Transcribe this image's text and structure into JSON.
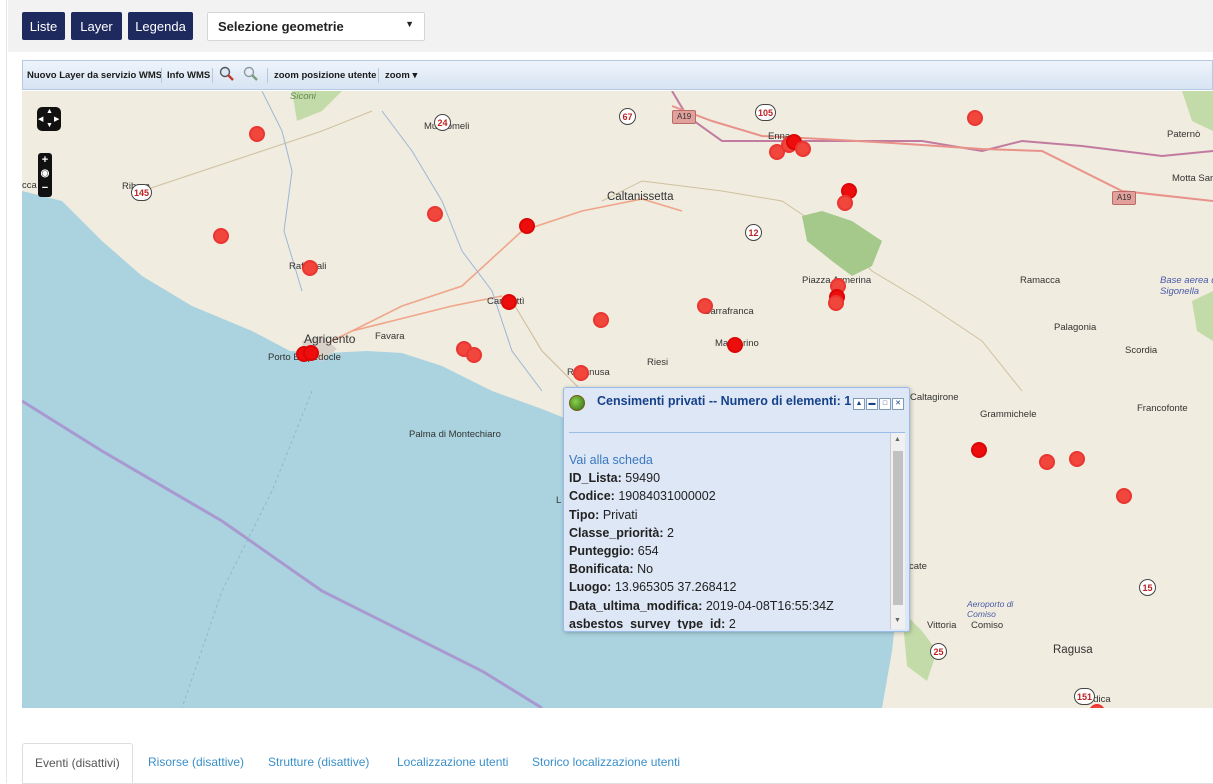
{
  "topbar": {
    "buttons": [
      "Liste",
      "Layer",
      "Legenda"
    ],
    "geometry_select": {
      "value": "Selezione geometrie"
    }
  },
  "toolbar": {
    "wms_layer": "Nuovo Layer da servizio WMS",
    "info_wms": "Info WMS",
    "zoom_user": "zoom posizione utente",
    "zoom": "zoom"
  },
  "map": {
    "labels": {
      "sicani": "Siconi",
      "mussomeli": "Mussomeli",
      "ribera": "Ribera",
      "raffadali": "Raffadali",
      "agrigento": "Agrigento",
      "favara": "Favara",
      "porto_empedocle": "Porto Empedocle",
      "caltanissetta": "Caltanissetta",
      "canicatti": "Canicattì",
      "barrafranca": "Barrafranca",
      "piazza_armerina": "Piazza Armerina",
      "mazzarino": "Mazzarino",
      "riesi": "Riesi",
      "ravanusa": "Ravanusa",
      "palma": "Palma di Montechiaro",
      "enna": "Enna",
      "paterno": "Paternò",
      "motta": "Motta San",
      "ramacca": "Ramacca",
      "sigonella": "Base aerea di Sigonella",
      "palagonia": "Palagonia",
      "scordia": "Scordia",
      "caltagirone": "Caltagirone",
      "grammichele": "Grammichele",
      "francofonte": "Francofonte",
      "aeroporto": "Aeroporto di Comiso",
      "vittoria": "Vittoria",
      "comiso": "Comiso",
      "ragusa": "Ragusa",
      "modica": "Modica",
      "licata": "L",
      "acate": "cate",
      "sciacca": "cca"
    },
    "road_badges": {
      "r24": "24",
      "r67": "67",
      "r105": "105",
      "r145": "145",
      "r12": "12",
      "r15": "15",
      "r25": "25",
      "r151": "151"
    },
    "highways": {
      "a19a": "A19",
      "a19b": "A19"
    }
  },
  "popup": {
    "title": "Censimenti privati  --  Numero di elementi: 1",
    "link": "Vai alla scheda",
    "fields": [
      {
        "key": "ID_Lista:",
        "value": "59490"
      },
      {
        "key": "Codice:",
        "value": "19084031000002"
      },
      {
        "key": "Tipo:",
        "value": "Privati"
      },
      {
        "key": "Classe_priorità:",
        "value": "2"
      },
      {
        "key": "Punteggio:",
        "value": "654"
      },
      {
        "key": "Bonificata:",
        "value": "No"
      },
      {
        "key": "Luogo:",
        "value": "13.965305 37.268412"
      },
      {
        "key": "Data_ultima_modifica:",
        "value": "2019-04-08T16:55:34Z"
      },
      {
        "key": "asbestos_survey_type_id:",
        "value": "2"
      }
    ]
  },
  "tabs": [
    "Eventi (disattivi)",
    "Risorse (disattive)",
    "Strutture (disattive)",
    "Localizzazione utenti",
    "Storico localizzazione utenti"
  ]
}
